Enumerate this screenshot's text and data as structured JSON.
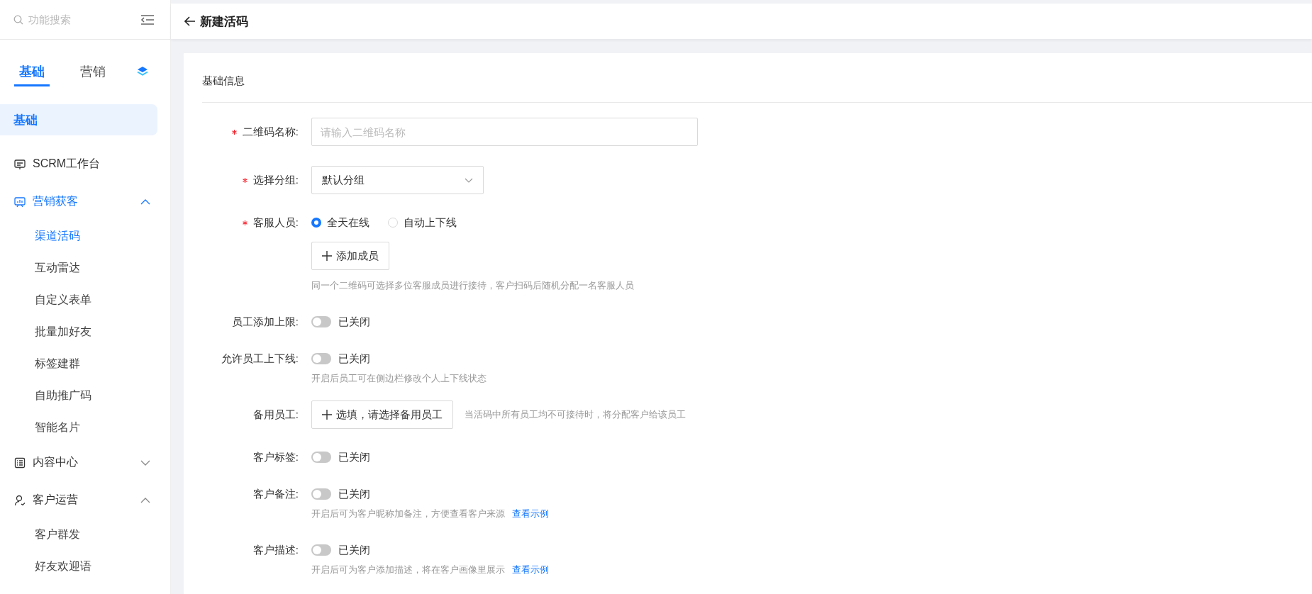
{
  "sidebar": {
    "search": {
      "placeholder": "功能搜索"
    },
    "tabs": [
      {
        "label": "基础",
        "selected": true
      },
      {
        "label": "营销",
        "selected": false
      }
    ],
    "section": {
      "label": "基础",
      "selected": true
    },
    "items": [
      {
        "label": "SCRM工作台",
        "selected": false
      },
      {
        "label": "营销获客",
        "expanded": true,
        "selected": true,
        "children": [
          {
            "label": "渠道活码",
            "selected": true
          },
          {
            "label": "互动雷达",
            "selected": false
          },
          {
            "label": "自定义表单",
            "selected": false
          },
          {
            "label": "批量加好友",
            "selected": false
          },
          {
            "label": "标签建群",
            "selected": false
          },
          {
            "label": "自助推广码",
            "selected": false
          },
          {
            "label": "智能名片",
            "selected": false
          }
        ]
      },
      {
        "label": "内容中心",
        "expanded": false,
        "selected": false
      },
      {
        "label": "客户运营",
        "expanded": true,
        "selected": false,
        "children": [
          {
            "label": "客户群发",
            "selected": false
          },
          {
            "label": "好友欢迎语",
            "selected": false
          }
        ]
      }
    ]
  },
  "header": {
    "title": "新建活码"
  },
  "form": {
    "section_title": "基础信息",
    "fields": [
      {
        "kind": "input",
        "label": "二维码名称:",
        "required": true,
        "placeholder": "请输入二维码名称"
      },
      {
        "kind": "select",
        "label": "选择分组:",
        "required": true,
        "value": "默认分组"
      },
      {
        "kind": "radio",
        "label": "客服人员:",
        "required": true,
        "options": [
          {
            "label": "全天在线",
            "selected": true
          },
          {
            "label": "自动上下线",
            "selected": false
          }
        ],
        "button": "添加成员",
        "hint": "同一个二维码可选择多位客服成员进行接待，客户扫码后随机分配一名客服人员"
      },
      {
        "kind": "switch",
        "label": "员工添加上限:",
        "required": false,
        "on": false,
        "status": "已关闭"
      },
      {
        "kind": "switch",
        "label": "允许员工上下线:",
        "required": false,
        "on": false,
        "status": "已关闭",
        "hint": "开启后员工可在侧边栏修改个人上下线状态"
      },
      {
        "kind": "picker",
        "label": "备用员工:",
        "required": false,
        "button": "选填，请选择备用员工",
        "side_hint": "当活码中所有员工均不可接待时，将分配客户给该员工"
      },
      {
        "kind": "switch",
        "label": "客户标签:",
        "required": false,
        "on": false,
        "status": "已关闭"
      },
      {
        "kind": "switch",
        "label": "客户备注:",
        "required": false,
        "on": false,
        "status": "已关闭",
        "hint": "开启后可为客户昵称加备注，方便查看客户来源",
        "link": "查看示例"
      },
      {
        "kind": "switch",
        "label": "客户描述:",
        "required": false,
        "on": false,
        "status": "已关闭",
        "hint": "开启后可为客户添加描述，将在客户画像里展示",
        "link": "查看示例"
      }
    ]
  }
}
